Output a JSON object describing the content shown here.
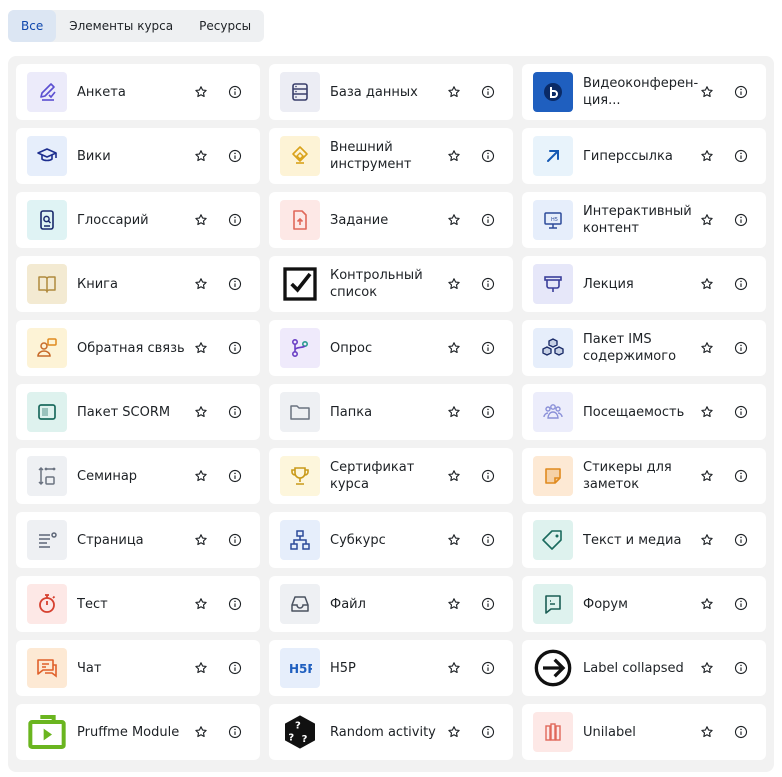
{
  "tabs": [
    "Все",
    "Элементы курса",
    "Ресурсы"
  ],
  "items": [
    {
      "label": "Анкета",
      "icon": "feedback-pencil-icon",
      "bg": "#ecebfa",
      "color": "#5b4fd1"
    },
    {
      "label": "База данных",
      "icon": "database-icon",
      "bg": "#ecedf4",
      "color": "#3a3f6b"
    },
    {
      "label": "Видеоконферен­ция...",
      "icon": "bigbluebutton-icon",
      "bg": "#1f5fbf",
      "color": "#ffffff"
    },
    {
      "label": "Вики",
      "icon": "wiki-icon",
      "bg": "#e6eefb",
      "color": "#1d2e8f"
    },
    {
      "label": "Внешний инструмент",
      "icon": "external-tool-icon",
      "bg": "#fdf3d6",
      "color": "#d9a21b"
    },
    {
      "label": "Гиперссылка",
      "icon": "hyperlink-icon",
      "bg": "#e8f3fb",
      "color": "#1458b3"
    },
    {
      "label": "Глоссарий",
      "icon": "glossary-icon",
      "bg": "#dff3f4",
      "color": "#1a2a6c"
    },
    {
      "label": "Задание",
      "icon": "assignment-icon",
      "bg": "#fde8e6",
      "color": "#e0685a"
    },
    {
      "label": "Интерактивный контент",
      "icon": "interactive-content-icon",
      "bg": "#e6eefb",
      "color": "#2c4a9a"
    },
    {
      "label": "Книга",
      "icon": "book-icon",
      "bg": "#f3ead2",
      "color": "#b08a3d"
    },
    {
      "label": "Контрольный список",
      "icon": "checklist-icon",
      "bg": "#ffffff",
      "color": "#111111"
    },
    {
      "label": "Лекция",
      "icon": "lecture-icon",
      "bg": "#e6e7f9",
      "color": "#3b3f9a"
    },
    {
      "label": "Обратная связь",
      "icon": "feedback-icon",
      "bg": "#fdf3d6",
      "color": "#c76b2a"
    },
    {
      "label": "Опрос",
      "icon": "choice-icon",
      "bg": "#efeafb",
      "color": "#6a3fc4"
    },
    {
      "label": "Пакет IMS содержимого",
      "icon": "ims-package-icon",
      "bg": "#e6eefb",
      "color": "#1d2e6a"
    },
    {
      "label": "Пакет SCORM",
      "icon": "scorm-icon",
      "bg": "#def2ee",
      "color": "#1b6b5e"
    },
    {
      "label": "Папка",
      "icon": "folder-icon",
      "bg": "#eef0f3",
      "color": "#6a7280"
    },
    {
      "label": "Посещаемость",
      "icon": "attendance-icon",
      "bg": "#ecedfb",
      "color": "#8a90d8"
    },
    {
      "label": "Семинар",
      "icon": "workshop-icon",
      "bg": "#eef0f3",
      "color": "#6a7280"
    },
    {
      "label": "Сертификат курса",
      "icon": "certificate-icon",
      "bg": "#fdf6dc",
      "color": "#c99a1a"
    },
    {
      "label": "Стикеры для заметок",
      "icon": "sticky-note-icon",
      "bg": "#fde9d4",
      "color": "#e08a1e"
    },
    {
      "label": "Страница",
      "icon": "page-icon",
      "bg": "#eef0f3",
      "color": "#5d6677"
    },
    {
      "label": "Субкурс",
      "icon": "subcourse-icon",
      "bg": "#e6eefb",
      "color": "#2c4a9a"
    },
    {
      "label": "Текст и медиа",
      "icon": "text-media-icon",
      "bg": "#def2ee",
      "color": "#1b6b5e"
    },
    {
      "label": "Тест",
      "icon": "quiz-icon",
      "bg": "#fde8e6",
      "color": "#d6402f"
    },
    {
      "label": "Файл",
      "icon": "file-icon",
      "bg": "#eef0f3",
      "color": "#4a5260"
    },
    {
      "label": "Форум",
      "icon": "forum-icon",
      "bg": "#def2ee",
      "color": "#1b5e55"
    },
    {
      "label": "Чат",
      "icon": "chat-icon",
      "bg": "#fde9d4",
      "color": "#e0602a"
    },
    {
      "label": "H5P",
      "icon": "h5p-icon",
      "bg": "#e6eefb",
      "color": "#1f5fbf"
    },
    {
      "label": "Label collapsed",
      "icon": "arrow-circle-icon",
      "bg": "#ffffff",
      "color": "#111111"
    },
    {
      "label": "Pruffme Module",
      "icon": "pruffme-icon",
      "bg": "#ffffff",
      "color": "#6ab51f"
    },
    {
      "label": "Random activity",
      "icon": "random-dice-icon",
      "bg": "#ffffff",
      "color": "#111111"
    },
    {
      "label": "Unilabel",
      "icon": "unilabel-icon",
      "bg": "#fde8e6",
      "color": "#e0685a"
    }
  ]
}
